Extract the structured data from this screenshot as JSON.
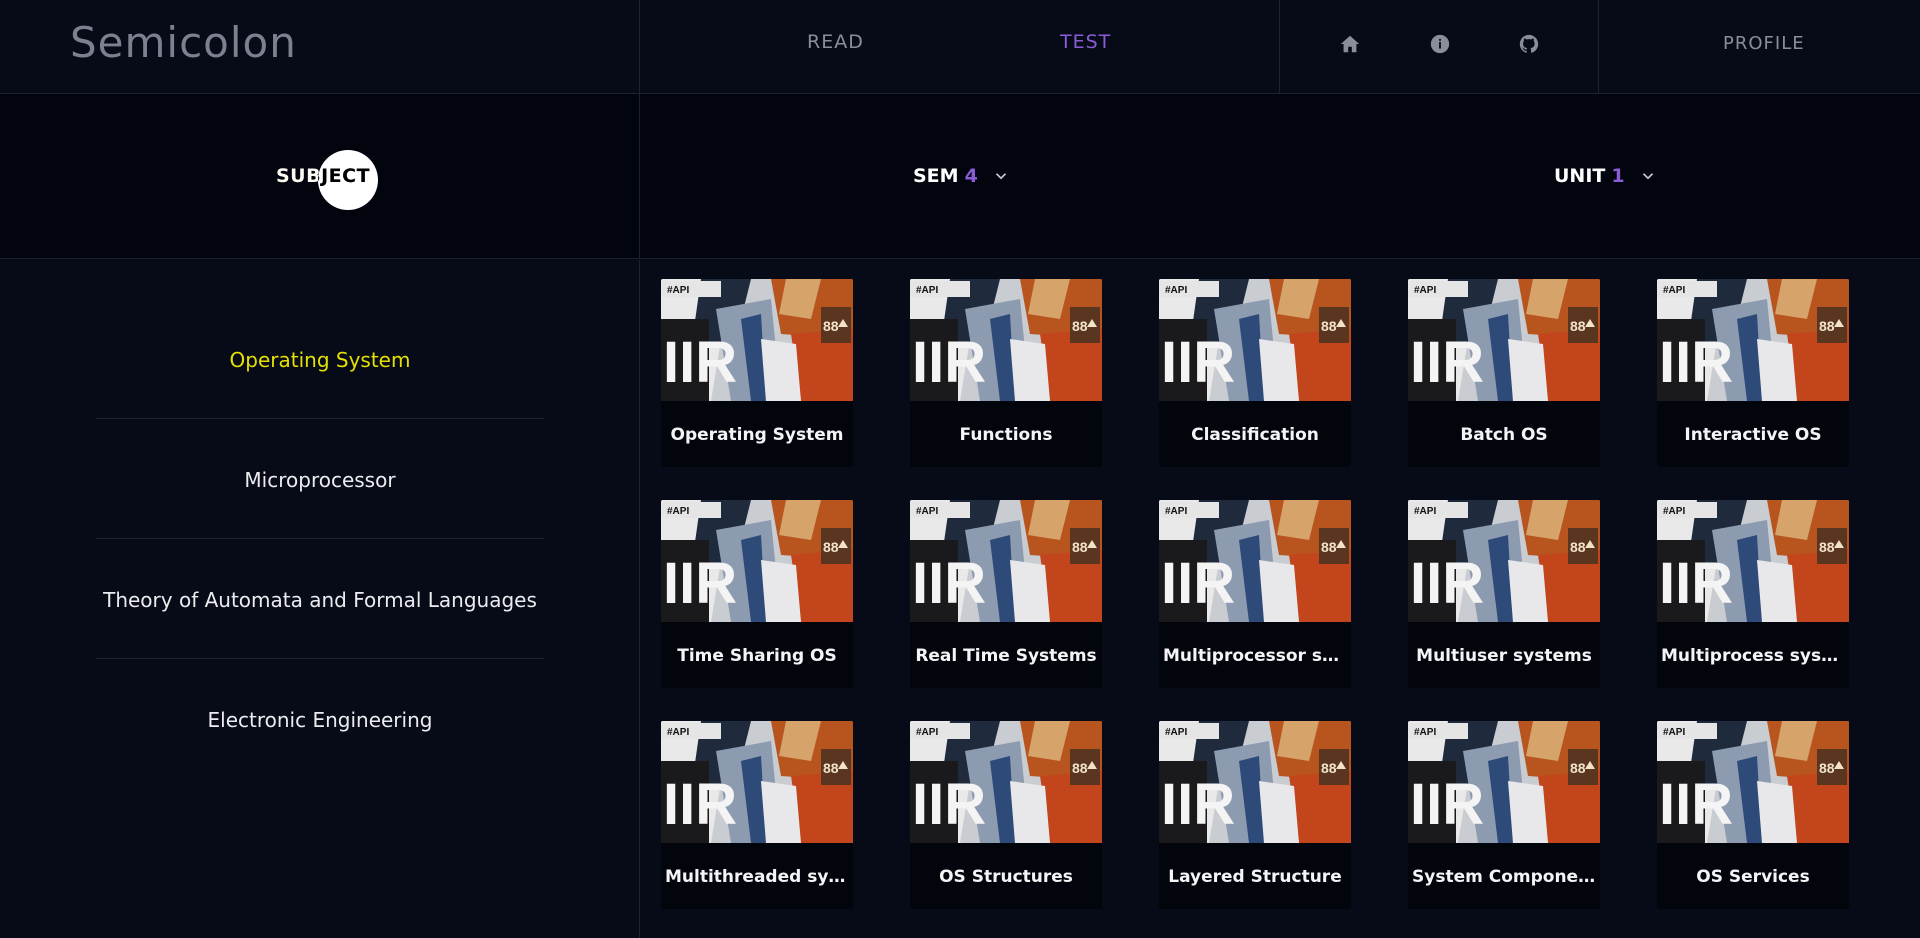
{
  "brand": "Semicolon",
  "nav": {
    "read": "READ",
    "test": "TEST",
    "icons": [
      "home-icon",
      "info-icon",
      "github-icon"
    ],
    "profile": "PROFILE"
  },
  "filters": {
    "subject_label": "SUBJECT",
    "sem_label": "SEM",
    "sem_value": "4",
    "unit_label": "UNIT",
    "unit_value": "1"
  },
  "colors": {
    "accent": "#8a5cd6",
    "active_subject": "#e4e000",
    "background": "#070b18"
  },
  "subjects": [
    "Operating System",
    "Microprocessor",
    "Theory of Automata and Formal Languages",
    "Electronic Engineering"
  ],
  "active_subject_index": 0,
  "topics": [
    "Operating System",
    "Functions",
    "Classification",
    "Batch OS",
    "Interactive OS",
    "Time Sharing OS",
    "Real Time Systems",
    "Multiprocessor sys...",
    "Multiuser systems",
    "Multiprocess syste...",
    "Multithreaded syst...",
    "OS Structures",
    "Layered Structure",
    "System Components",
    "OS Services"
  ],
  "thumb_text": {
    "tag": "#API",
    "badge": "88",
    "letters": "IIR"
  }
}
